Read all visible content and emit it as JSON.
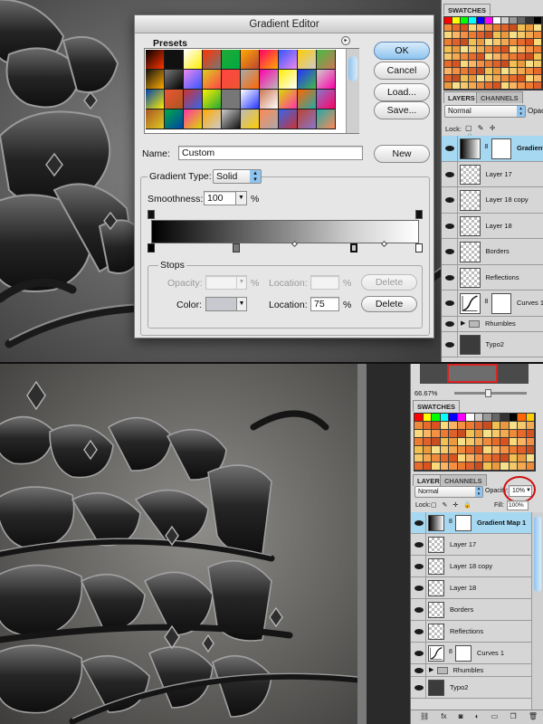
{
  "gradient_editor": {
    "title": "Gradient Editor",
    "presets_label": "Presets",
    "buttons": {
      "ok": "OK",
      "cancel": "Cancel",
      "load": "Load...",
      "save": "Save...",
      "new": "New",
      "delete_opacity": "Delete",
      "delete_color": "Delete"
    },
    "name_label": "Name:",
    "name_value": "Custom",
    "gradient_type_label": "Gradient Type:",
    "gradient_type_value": "Solid",
    "smoothness_label": "Smoothness:",
    "smoothness_value": "100",
    "percent": "%",
    "stops_label": "Stops",
    "opacity_label": "Opacity:",
    "opacity_value": "",
    "location_label": "Location:",
    "location_opacity_value": "",
    "color_label": "Color:",
    "location_color_value": "75",
    "color_stop_swatch": "#c8c8cf",
    "presets": [
      "#000000",
      "#111111",
      "#ffffff",
      "#ff3300",
      "#22aa33",
      "#ffaa00",
      "#ff0066",
      "#3355ff",
      "#ffcc00",
      "#44bb44",
      "#111111",
      "#777777",
      "#ee88ee",
      "#ddcc22",
      "#ff4444",
      "#aaaaaa",
      "#ff00aa",
      "#ffee00",
      "#2233ff",
      "#cccccc",
      "#0044aa",
      "#ee5533",
      "#cc3333",
      "#ffee00",
      "#777777",
      "#ffffff",
      "#cc7755",
      "#ddd800",
      "#ff6600",
      "#8877cc",
      "#aa5522",
      "#00aa44",
      "#ff33aa",
      "#ffaa00",
      "#cccccc",
      "#bbbbbb",
      "#ff8855",
      "#3366ee",
      "#bb4433",
      "#22aaaa"
    ]
  },
  "top_panel": {
    "swatches_tab": "SWATCHES",
    "layers_tab": "LAYERS",
    "channels_tab": "CHANNELS",
    "blend_mode": "Normal",
    "opacity_label": "Opaci",
    "lock_label": "Lock:",
    "layers": [
      {
        "name": "Gradient",
        "kind": "gradient"
      },
      {
        "name": "Layer 17",
        "kind": "pixel"
      },
      {
        "name": "Layer 18 copy",
        "kind": "pixel"
      },
      {
        "name": "Layer 18",
        "kind": "pixel"
      },
      {
        "name": "Borders",
        "kind": "pixel"
      },
      {
        "name": "Reflections",
        "kind": "pixel"
      },
      {
        "name": "Curves 1",
        "kind": "curves"
      },
      {
        "name": "Rhumbles",
        "kind": "group"
      },
      {
        "name": "Typo2",
        "kind": "typo"
      }
    ]
  },
  "bottom_panel": {
    "zoom": "66.67%",
    "swatches_tab": "SWATCHES",
    "layers_tab": "LAYERS",
    "channels_tab": "CHANNELS",
    "blend_mode": "Normal",
    "opacity_label": "Opacity:",
    "opacity_value": "10%",
    "lock_label": "Lock:",
    "fill_label": "Fill:",
    "fill_value": "100%",
    "layers": [
      {
        "name": "Gradient Map 1",
        "kind": "gradient"
      },
      {
        "name": "Layer 17",
        "kind": "pixel"
      },
      {
        "name": "Layer 18 copy",
        "kind": "pixel"
      },
      {
        "name": "Layer 18",
        "kind": "pixel"
      },
      {
        "name": "Borders",
        "kind": "pixel"
      },
      {
        "name": "Reflections",
        "kind": "pixel"
      },
      {
        "name": "Curves 1",
        "kind": "curves"
      },
      {
        "name": "Rhumbles",
        "kind": "group"
      },
      {
        "name": "Typo2",
        "kind": "typo"
      }
    ],
    "footer_icons": [
      "link-icon",
      "fx-icon",
      "mask-icon",
      "adjustment-icon",
      "folder-icon",
      "new-layer-icon",
      "trash-icon"
    ]
  },
  "colors": {
    "highlight": "#a6d8f2",
    "annotation": "#cc1111"
  }
}
